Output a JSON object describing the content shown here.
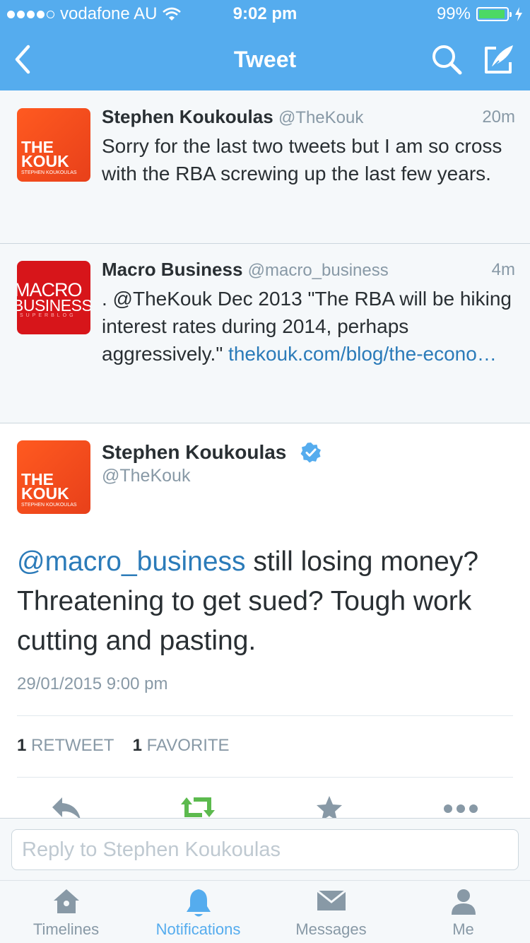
{
  "status_bar": {
    "carrier": "vodafone AU",
    "time": "9:02 pm",
    "battery": "99%",
    "battery_level": 0.99
  },
  "nav": {
    "title": "Tweet",
    "back_icon": "chevron-left-icon",
    "search_icon": "search-icon",
    "compose_icon": "compose-icon"
  },
  "tweets": [
    {
      "name": "Stephen Koukoulas",
      "handle": "@TheKouk",
      "time": "20m",
      "text": "Sorry for the last two tweets but I am so cross with the RBA screwing up the last few years.",
      "avatar": {
        "line1": "THE",
        "line2": "KOUK",
        "line3": "STEPHEN KOUKOULAS"
      }
    },
    {
      "name": "Macro Business",
      "handle": "@macro_business",
      "time": "4m",
      "text": ". @TheKouk Dec 2013 \"The RBA will be hiking interest rates during 2014, perhaps aggressively.\" ",
      "link": "thekouk.com/blog/the-econo…",
      "avatar": {
        "line1": "MACRO",
        "line2": "BUSINESS",
        "line3": "SUPERBLOG"
      }
    }
  ],
  "main_tweet": {
    "name": "Stephen Koukoulas",
    "handle": "@TheKouk",
    "mention": "@macro_business",
    "text": " still losing money? Threatening to get sued?  Tough work cutting and pasting.",
    "date": "29/01/2015 9:00 pm",
    "retweet_count": "1",
    "retweet_label": "RETWEET",
    "favorite_count": "1",
    "favorite_label": "FAVORITE",
    "avatar": {
      "line1": "THE",
      "line2": "KOUK",
      "line3": "STEPHEN KOUKOULAS"
    }
  },
  "reply": {
    "placeholder": "Reply to Stephen Koukoulas"
  },
  "tabs": [
    {
      "label": "Timelines",
      "icon": "home-icon",
      "active": false
    },
    {
      "label": "Notifications",
      "icon": "bell-icon",
      "active": true
    },
    {
      "label": "Messages",
      "icon": "envelope-icon",
      "active": false
    },
    {
      "label": "Me",
      "icon": "person-icon",
      "active": false
    }
  ],
  "colors": {
    "brand_blue": "#55acee",
    "link_blue": "#2b7bb9",
    "retweet_green": "#5cba4e",
    "muted": "#8899a6"
  }
}
